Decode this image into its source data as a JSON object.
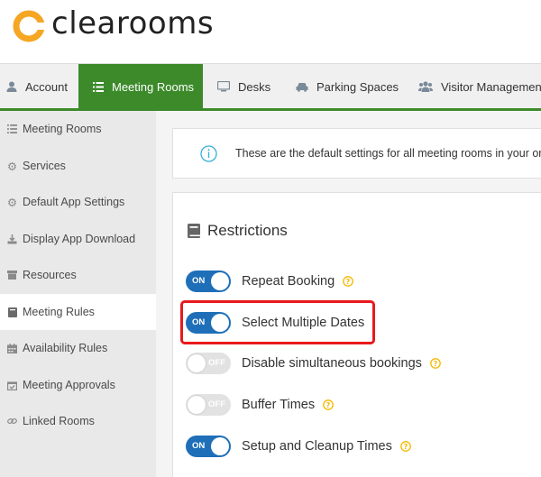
{
  "brand": {
    "name": "clearooms",
    "logo_color": "#f5a623"
  },
  "nav": {
    "tabs": [
      {
        "label": "Account",
        "icon": "user-icon",
        "active": false
      },
      {
        "label": "Meeting Rooms",
        "icon": "list-icon",
        "active": true
      },
      {
        "label": "Desks",
        "icon": "monitor-icon",
        "active": false
      },
      {
        "label": "Parking Spaces",
        "icon": "car-icon",
        "active": false
      },
      {
        "label": "Visitor Management",
        "icon": "users-icon",
        "active": false
      }
    ],
    "accent_color": "#3c8a2a"
  },
  "sidebar": {
    "items": [
      {
        "label": "Meeting Rooms",
        "icon": "list-icon"
      },
      {
        "label": "Services",
        "icon": "gear-icon"
      },
      {
        "label": "Default App Settings",
        "icon": "gear-icon"
      },
      {
        "label": "Display App Download",
        "icon": "download-icon"
      },
      {
        "label": "Resources",
        "icon": "box-icon"
      },
      {
        "label": "Meeting Rules",
        "icon": "book-icon",
        "active": true
      },
      {
        "label": "Availability Rules",
        "icon": "calendar-icon"
      },
      {
        "label": "Meeting Approvals",
        "icon": "calendar-check-icon"
      },
      {
        "label": "Linked Rooms",
        "icon": "link-icon"
      }
    ]
  },
  "info": {
    "text": "These are the default settings for all meeting rooms in your org"
  },
  "restrictions": {
    "title": "Restrictions",
    "items": [
      {
        "label": "Repeat Booking",
        "state": "ON",
        "on": true
      },
      {
        "label": "Select Multiple Dates",
        "state": "ON",
        "on": true,
        "highlighted": true
      },
      {
        "label": "Disable simultaneous bookings",
        "state": "OFF",
        "on": false
      },
      {
        "label": "Buffer Times",
        "state": "OFF",
        "on": false
      },
      {
        "label": "Setup and Cleanup Times",
        "state": "ON",
        "on": true
      }
    ]
  },
  "colors": {
    "toggle_on": "#1e6fb8",
    "toggle_off": "#e2e2e2",
    "highlight": "#e8191c",
    "help": "#f5b800",
    "info": "#3ab0d8"
  }
}
